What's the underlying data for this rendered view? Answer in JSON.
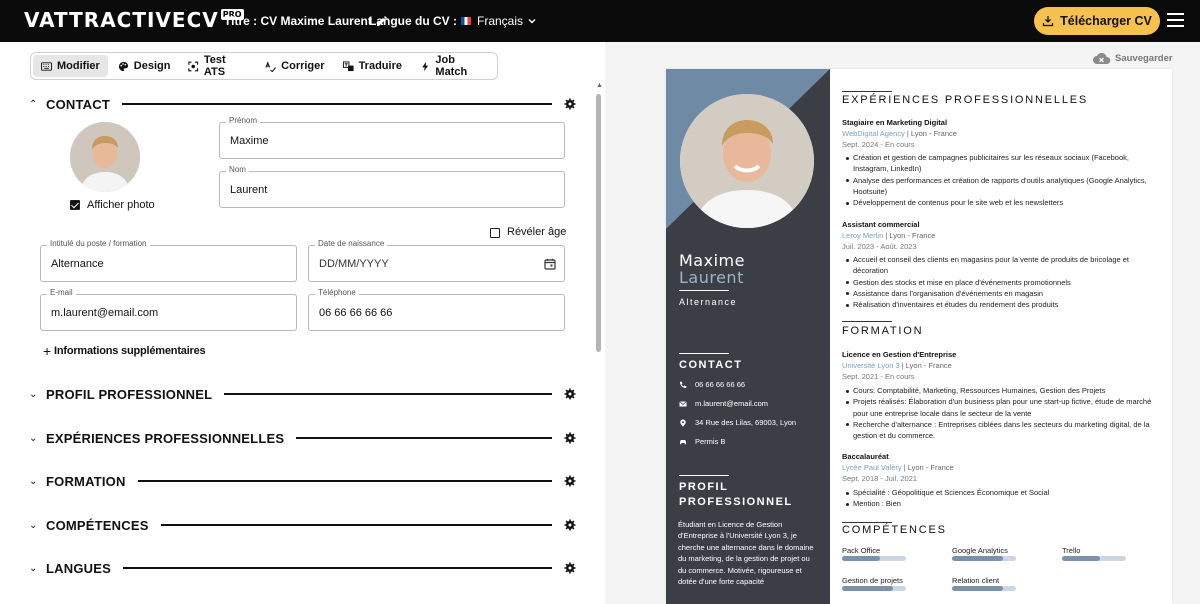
{
  "app": {
    "logo_text": "VATTRACTIVECV",
    "logo_badge": "PRO",
    "title_label": "Titre : CV Maxime Laurent",
    "lang_label": "Langue du CV :",
    "lang_value": "Français",
    "download_label": "Télécharger CV"
  },
  "tabs": [
    {
      "label": "Modifier",
      "icon": "keyboard-icon"
    },
    {
      "label": "Design",
      "icon": "palette-icon"
    },
    {
      "label": "Test ATS",
      "icon": "scan-icon"
    },
    {
      "label": "Corriger",
      "icon": "spellcheck-icon"
    },
    {
      "label": "Traduire",
      "icon": "translate-icon"
    },
    {
      "label": "Job Match",
      "icon": "bolt-icon"
    }
  ],
  "sections": {
    "contact": "CONTACT",
    "profil": "PROFIL PROFESSIONNEL",
    "experiences": "EXPÉRIENCES PROFESSIONNELLES",
    "formation": "FORMATION",
    "competences": "COMPÉTENCES",
    "langues": "LANGUES"
  },
  "contact_form": {
    "show_photo": "Afficher photo",
    "reveal_age": "Révéler âge",
    "prenom_label": "Prénom",
    "prenom": "Maxime",
    "nom_label": "Nom",
    "nom": "Laurent",
    "poste_label": "Intitulé du poste / formation",
    "poste": "Alternance",
    "naissance_label": "Date de naissance",
    "naissance_placeholder": "DD/MM/YYYY",
    "email_label": "E-mail",
    "email": "m.laurent@email.com",
    "tel_label": "Téléphone",
    "tel": "06 66 66 66 66",
    "more_info": "Informations supplémentaires"
  },
  "save_label": "Sauvegarder",
  "cv": {
    "first_name": "Maxime",
    "last_name": "Laurent",
    "job": "Alternance",
    "contact_title": "CONTACT",
    "phone": "06 66 66 66 66",
    "email": "m.laurent@email.com",
    "address": "34 Rue des Lilas, 69003, Lyon",
    "permit": "Permis B",
    "profile_title_1": "PROFIL",
    "profile_title_2": "PROFESSIONNEL",
    "profile_text": "Étudiant en Licence de Gestion d'Entreprise à l'Université Lyon 3, je cherche une alternance dans le domaine du marketing, de la gestion de projet ou du commerce. Motivée, rigoureuse et dotée d'une forte capacité",
    "exp_title": "EXPÉRIENCES PROFESSIONNELLES",
    "experiences": [
      {
        "title": "Stagiaire en Marketing Digital",
        "company": "WebDigital Agency",
        "location": " | Lyon - France",
        "dates": "Sept. 2024 - En cours",
        "bullets": [
          "Création et gestion de campagnes publicitaires sur les réseaux sociaux (Facebook, Instagram, LinkedIn)",
          "Analyse des performances et création de rapports d'outils analytiques (Google Analytics, Hootsuite)",
          "Développement de contenus pour le site web et les newsletters"
        ]
      },
      {
        "title": "Assistant commercial",
        "company": "Leroy Merlin",
        "location": " | Lyon - France",
        "dates": "Juil. 2023 - Août. 2023",
        "bullets": [
          "Accueil et conseil des clients en magasins pour la vente de produits de bricolage et décoration",
          "Gestion des stocks et mise en place d'événements promotionnels",
          "Assistance dans l'organisation d'événements en magasin",
          "Réalisation d'inventaires et études du rendement des produits"
        ]
      }
    ],
    "formation_title": "FORMATION",
    "formations": [
      {
        "title": "Licence en Gestion d'Entreprise",
        "school": "Université Lyon 3",
        "location": " | Lyon - France",
        "dates": "Sept. 2021 - En cours",
        "bullets": [
          "Cours: Comptabilité, Marketing, Ressources Humaines, Gestion des Projets",
          "Projets réalisés: Élaboration d'un business plan pour une start-up fictive, étude de marché pour une entreprise locale dans le secteur de la vente",
          "Recherche d'alternance : Entreprises ciblées dans les secteurs du marketing digital, de la gestion et du commerce."
        ]
      },
      {
        "title": "Baccalauréat",
        "school": "Lycée Paul Valéry",
        "location": " | Lyon - France",
        "dates": "Sept. 2018 - Juil. 2021",
        "bullets": [
          "Spécialité : Géopolitique et Sciences Économique et Social",
          "Mention : Bien"
        ]
      }
    ],
    "skills_title": "COMPÉTENCES",
    "skills": [
      {
        "name": "Pack Office",
        "level": 0.6
      },
      {
        "name": "Google Analytics",
        "level": 0.8
      },
      {
        "name": "Trello",
        "level": 0.6
      },
      {
        "name": "Gestion de projets",
        "level": 0.8
      },
      {
        "name": "Relation client",
        "level": 0.8
      }
    ]
  },
  "colors": {
    "topbar": "#0b0b0b",
    "accent": "#f6c24d",
    "cv_sidebar": "#3b3f45",
    "cv_accent": "#7aa0c2"
  }
}
